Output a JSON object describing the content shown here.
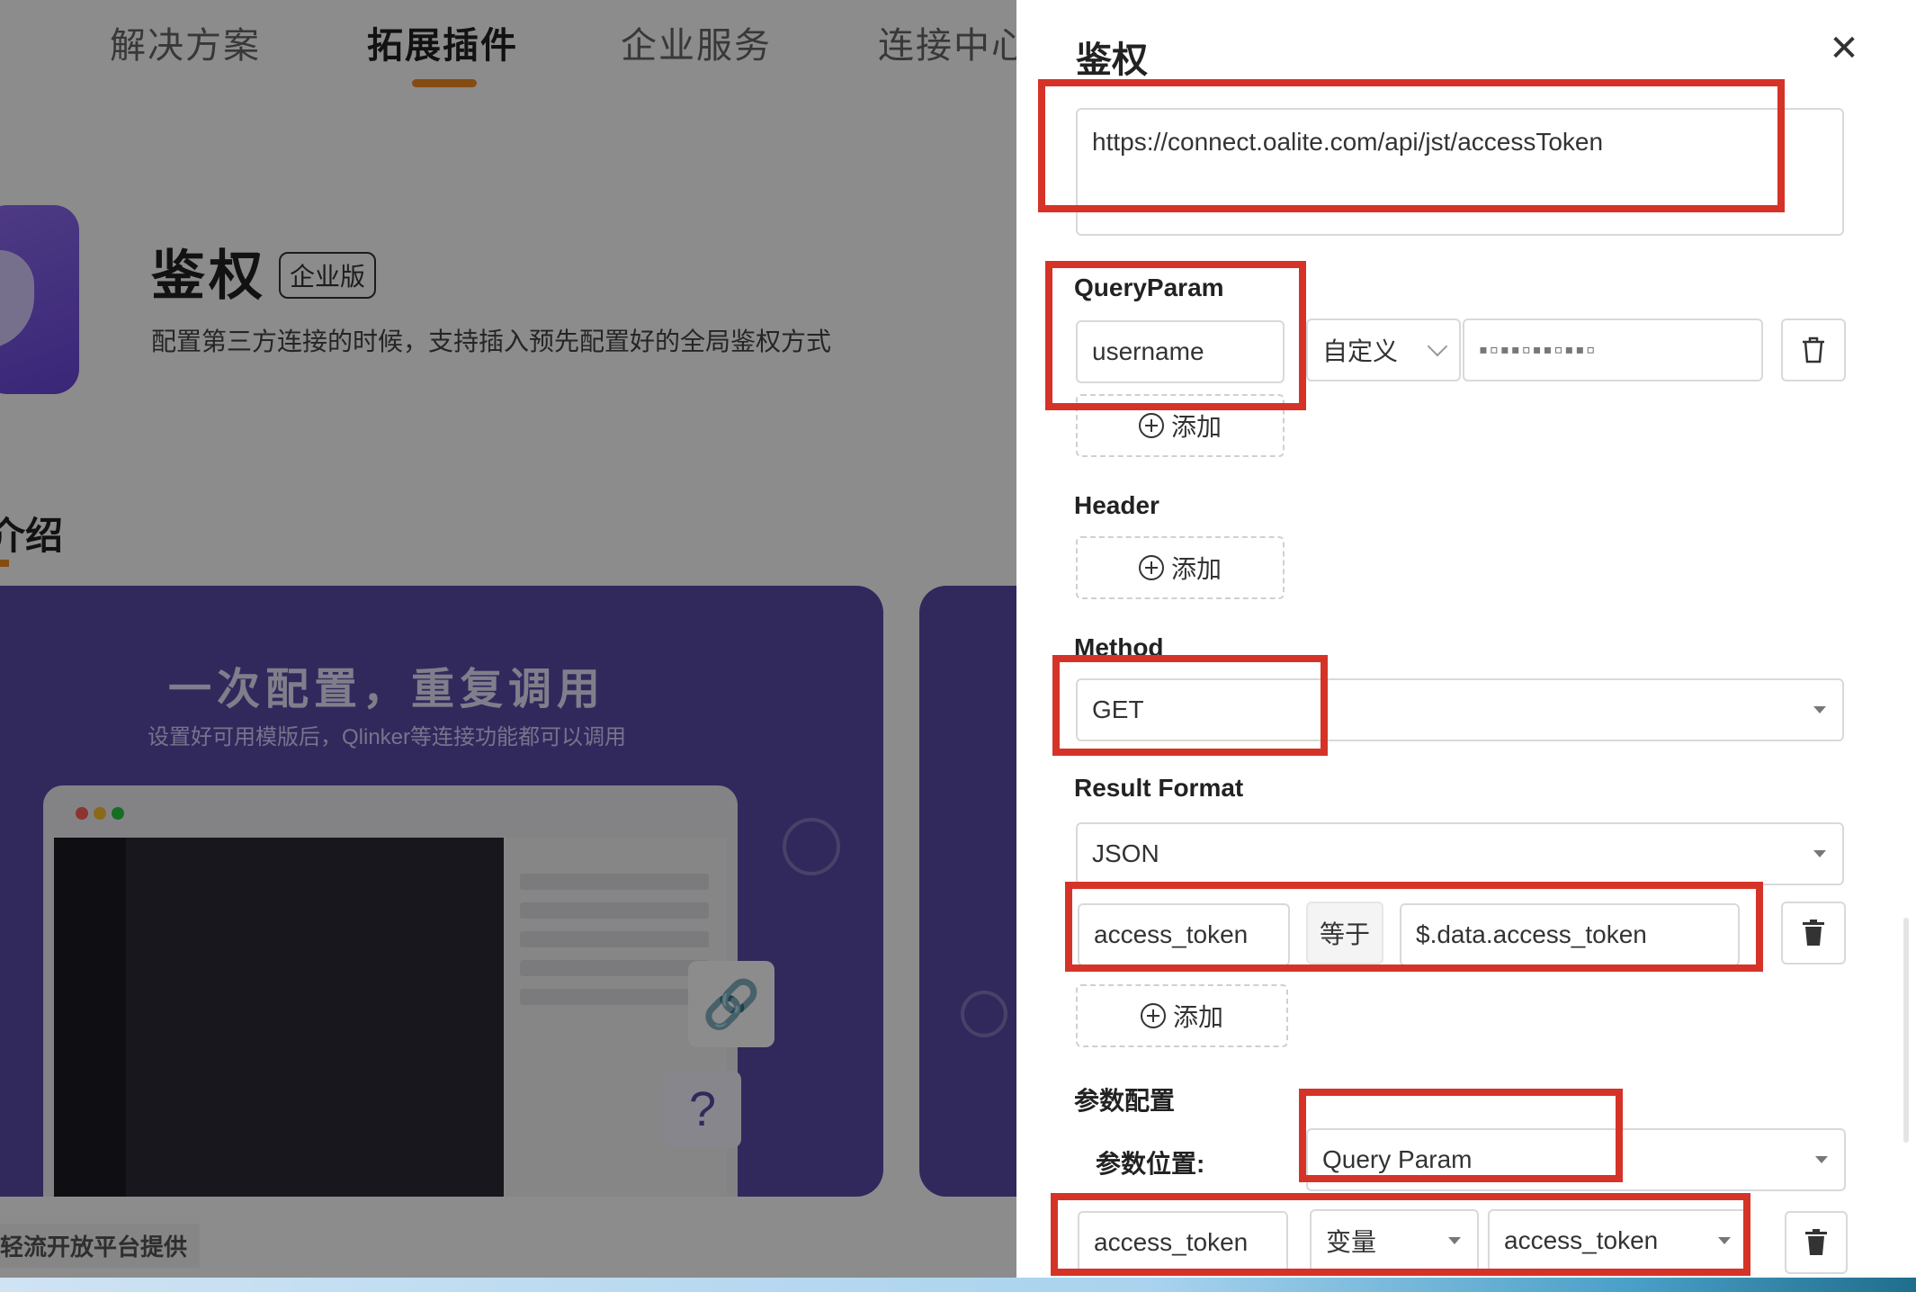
{
  "background": {
    "nav": [
      "解决方案",
      "拓展插件",
      "企业服务",
      "连接中心"
    ],
    "plugin_title": "鉴权",
    "plugin_badge": "企业版",
    "plugin_desc": "配置第三方连接的时候，支持插入预先配置好的全局鉴权方式",
    "intro_heading": "介绍",
    "banner_title": "一次配置，重复调用",
    "banner_sub": "设置好可用模版后，Qlinker等连接功能都可以调用",
    "footer_note": "轻流开放平台提供"
  },
  "drawer": {
    "title": "鉴权",
    "url_value": "https://connect.oalite.com/api/jst/accessToken",
    "query_param": {
      "label": "QueryParam",
      "key": "username",
      "type": "自定义",
      "add_label": "添加"
    },
    "header": {
      "label": "Header",
      "add_label": "添加"
    },
    "method": {
      "label": "Method",
      "value": "GET"
    },
    "result_format": {
      "label": "Result Format",
      "value": "JSON",
      "key": "access_token",
      "operator": "等于",
      "path": "$.data.access_token",
      "add_label": "添加"
    },
    "param_config": {
      "label": "参数配置",
      "location_label": "参数位置:",
      "location_value": "Query Param",
      "key": "access_token",
      "type": "变量",
      "var_value": "access_token"
    }
  },
  "colors": {
    "highlight": "#d63328",
    "accent": "#f08a24",
    "banner": "#5a4ba8"
  },
  "icons": [
    "close-icon",
    "plus-circle-icon",
    "trash-icon",
    "link-icon",
    "question-icon"
  ]
}
